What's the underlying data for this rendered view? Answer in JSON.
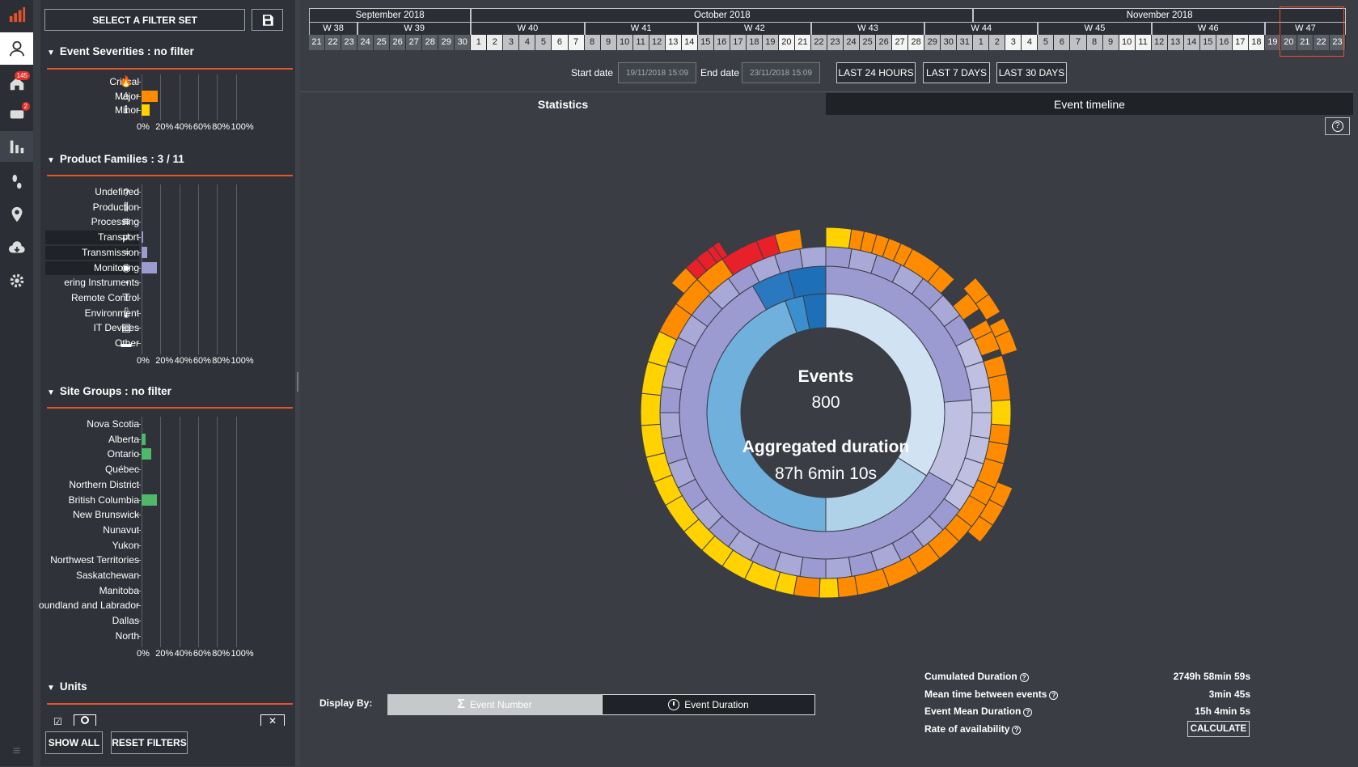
{
  "rail": {
    "badges": {
      "home": "145",
      "tickets": "2"
    }
  },
  "filters": {
    "select_label": "SELECT A FILTER SET",
    "sections": {
      "severities": "Event Severities : no filter",
      "families": "Product Families : 3 / 11",
      "sites": "Site Groups : no filter",
      "units": "Units"
    },
    "severities": [
      {
        "label": "Critical",
        "icon": "fire-icon",
        "pct": 0,
        "color": "#e8202a"
      },
      {
        "label": "Major",
        "icon": "warning-icon",
        "pct": 0.08,
        "color": "#ff8c00"
      },
      {
        "label": "Minor",
        "icon": "info-icon",
        "pct": 0.04,
        "color": "#ffd200"
      }
    ],
    "families": [
      {
        "label": "Undefined",
        "icon": "question-icon",
        "pct": 0
      },
      {
        "label": "Production",
        "icon": "production-icon",
        "pct": 0
      },
      {
        "label": "Processing",
        "icon": "processing-icon",
        "pct": 0
      },
      {
        "label": "Transport",
        "icon": "transport-icon",
        "pct": 0.01,
        "selected": true
      },
      {
        "label": "Transmission",
        "icon": "transmission-icon",
        "pct": 0.03,
        "selected": true
      },
      {
        "label": "Monitoring",
        "icon": "monitoring-icon",
        "pct": 0.08,
        "selected": true
      },
      {
        "label": "ering Instruments",
        "icon": "gauge-icon",
        "pct": 0
      },
      {
        "label": "Remote Control",
        "icon": "remote-icon",
        "pct": 0
      },
      {
        "label": "Environment",
        "icon": "thermometer-icon",
        "pct": 0
      },
      {
        "label": "IT Devices",
        "icon": "server-icon",
        "pct": 0
      },
      {
        "label": "Other",
        "icon": "other-icon",
        "pct": 0
      }
    ],
    "sites": [
      {
        "label": "Nova Scotia",
        "pct": 0
      },
      {
        "label": "Alberta",
        "pct": 0.02
      },
      {
        "label": "Ontario",
        "pct": 0.05
      },
      {
        "label": "Québec",
        "pct": 0
      },
      {
        "label": "Northern District",
        "pct": 0
      },
      {
        "label": "British Columbia",
        "pct": 0.08
      },
      {
        "label": "New Brunswick",
        "pct": 0
      },
      {
        "label": "Nunavut",
        "pct": 0
      },
      {
        "label": "Yukon",
        "pct": 0
      },
      {
        "label": "Northwest Territories",
        "pct": 0
      },
      {
        "label": "Saskatchewan",
        "pct": 0
      },
      {
        "label": "Manitoba",
        "pct": 0
      },
      {
        "label": "oundland and Labrador",
        "pct": 0
      },
      {
        "label": "Dallas",
        "pct": 0
      },
      {
        "label": "North",
        "pct": 0
      }
    ],
    "axis_ticks": [
      "0%",
      "20%",
      "40%",
      "60%",
      "80%",
      "100%"
    ],
    "show_all": "SHOW ALL",
    "reset": "RESET FILTERS"
  },
  "calendar": {
    "months": [
      "September 2018",
      "October 2018",
      "November 2018"
    ],
    "weeks": [
      "W 38",
      "W 39",
      "W 40",
      "W 41",
      "W 42",
      "W 43",
      "W 44",
      "W 45",
      "W 46",
      "W 47"
    ],
    "days": [
      "21",
      "22",
      "23",
      "24",
      "25",
      "26",
      "27",
      "28",
      "29",
      "30",
      "1",
      "2",
      "3",
      "4",
      "5",
      "6",
      "7",
      "8",
      "9",
      "10",
      "11",
      "12",
      "13",
      "14",
      "15",
      "16",
      "17",
      "18",
      "19",
      "20",
      "21",
      "22",
      "23",
      "24",
      "25",
      "26",
      "27",
      "28",
      "29",
      "30",
      "31",
      "1",
      "2",
      "3",
      "4",
      "5",
      "6",
      "7",
      "8",
      "9",
      "10",
      "11",
      "12",
      "13",
      "14",
      "15",
      "16",
      "17",
      "18",
      "19",
      "20",
      "21",
      "22",
      "23"
    ]
  },
  "dates": {
    "start_label": "Start date",
    "start_value": "19/11/2018 15:09",
    "end_label": "End date",
    "end_value": "23/11/2018 15:09",
    "quick": [
      "LAST 24 HOURS",
      "LAST 7 DAYS",
      "LAST 30 DAYS"
    ]
  },
  "tabs": [
    "Statistics",
    "Event timeline"
  ],
  "center": {
    "events_label": "Events",
    "events_value": "800",
    "duration_label": "Aggregated duration",
    "duration_value": "87h 6min 10s"
  },
  "display_by": {
    "label": "Display By:",
    "options": [
      "Event Number",
      "Event Duration"
    ],
    "active": "Event Duration"
  },
  "stats": [
    {
      "label": "Cumulated Duration",
      "value": "2749h 58min 59s"
    },
    {
      "label": "Mean time between events",
      "value": "3min 45s"
    },
    {
      "label": "Event Mean Duration",
      "value": "15h 4min 5s"
    },
    {
      "label": "Rate of availability",
      "value": "CALCULATE"
    }
  ],
  "colors": {
    "accent": "#e4532a",
    "critical": "#e8202a",
    "major": "#ff8c00",
    "minor": "#ffd200",
    "ring_inner_light": "#c7dcee",
    "ring_inner_mid": "#6fb0dc",
    "ring_inner_dark": "#1d6fb8",
    "ring_purple": "#9b9bd2",
    "ring_purple_light": "#bfbfe2",
    "site_bar": "#4fb86a"
  }
}
